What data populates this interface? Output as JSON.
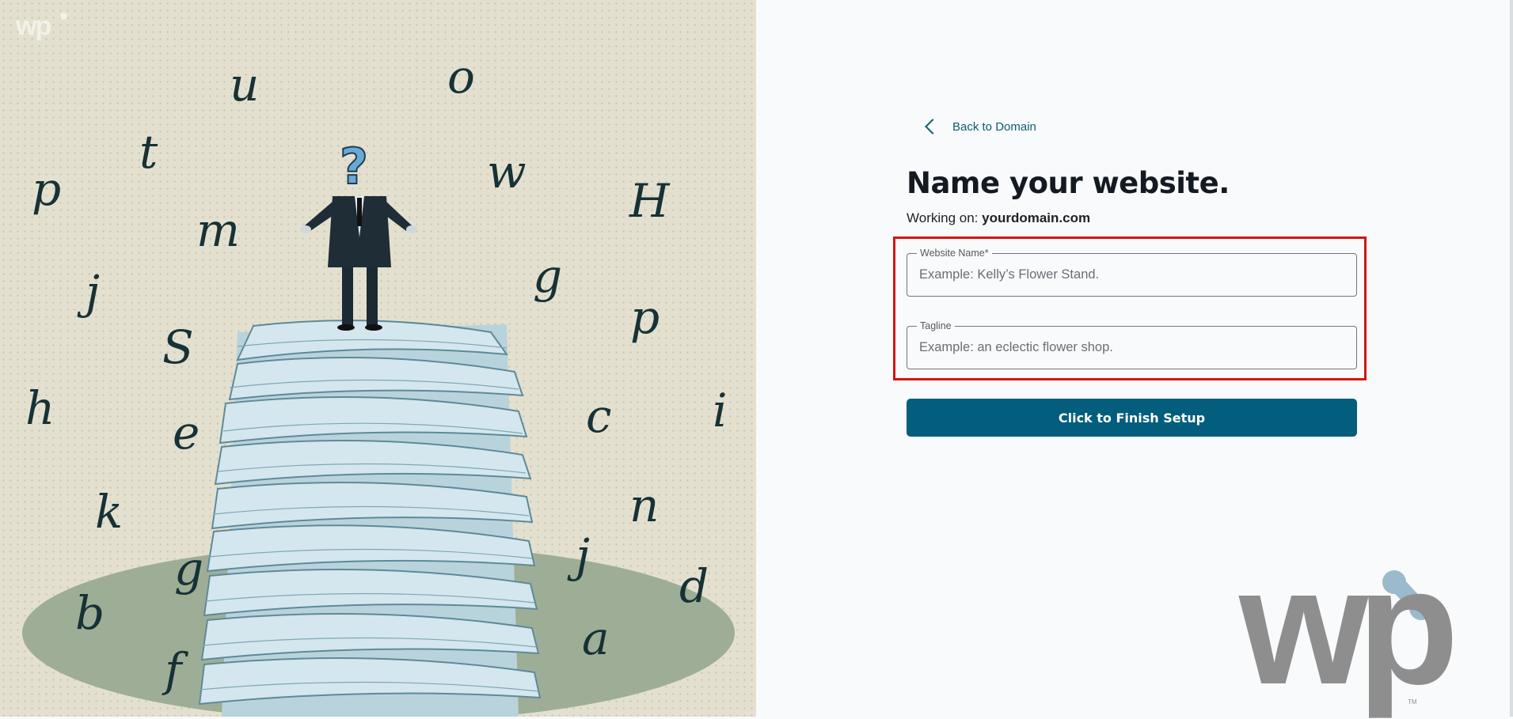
{
  "hero": {
    "logo": "wp",
    "letters": [
      "u",
      "o",
      "p",
      "t",
      "w",
      "H",
      "m",
      "j",
      "g",
      "p",
      "S",
      "h",
      "e",
      "c",
      "i",
      "k",
      "n",
      "j",
      "g",
      "d",
      "b",
      "f",
      "a"
    ]
  },
  "nav": {
    "back_label": "Back to Domain",
    "back_icon": "chevron-left-icon"
  },
  "page": {
    "title": "Name your website.",
    "working_prefix": "Working on: ",
    "domain": "yourdomain.com"
  },
  "form": {
    "website_name": {
      "label": "Website Name*",
      "placeholder": "Example: Kelly’s Flower Stand.",
      "value": ""
    },
    "tagline": {
      "label": "Tagline",
      "placeholder": "Example: an eclectic flower shop.",
      "value": ""
    },
    "submit_label": "Click to Finish Setup"
  },
  "brand": {
    "mark": "wp",
    "tm": "TM"
  },
  "colors": {
    "primary": "#025e7c",
    "link": "#0f5d6b",
    "highlight_border": "#d31515",
    "background": "#f8fafc",
    "brand_grey": "#8e8e8e",
    "brand_accent": "#9bbacb"
  }
}
